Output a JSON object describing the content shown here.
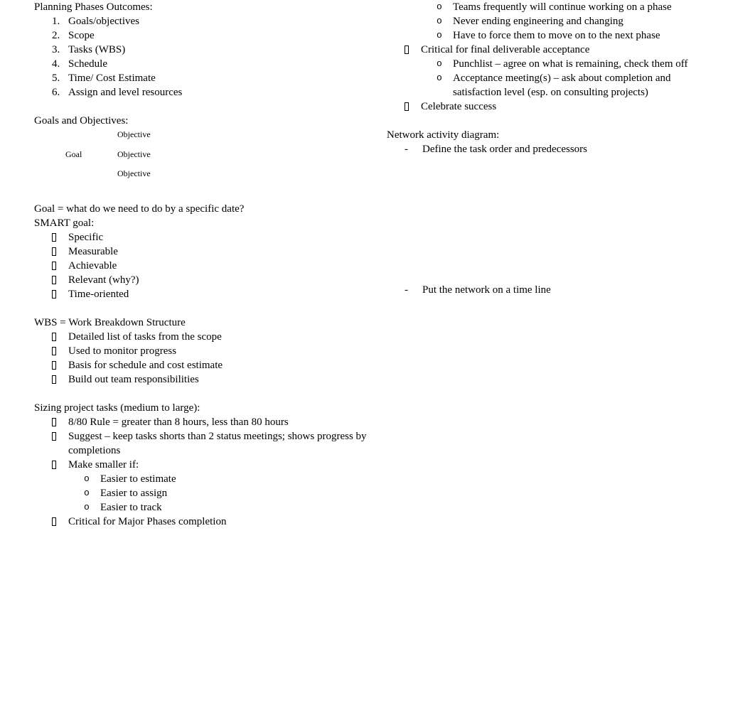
{
  "document": {
    "left_column": {
      "planning_phases": {
        "heading": "Planning Phases Outcomes:",
        "items": [
          {
            "marker": "1.",
            "label": "Goals/objectives"
          },
          {
            "marker": "2.",
            "label": "Scope"
          },
          {
            "marker": "3.",
            "label": "Tasks (WBS)"
          },
          {
            "marker": "4.",
            "label": "Schedule"
          },
          {
            "marker": "5.",
            "label": "Time/ Cost Estimate"
          },
          {
            "marker": "6.",
            "label": "Assign and level resources"
          }
        ]
      },
      "goals_objectives": {
        "heading": "Goals and Objectives:",
        "diagram": {
          "goal": "Goal",
          "objective_1": "Objective",
          "objective_2": "Objective",
          "objective_3": "Objective"
        }
      },
      "goal_definition": "Goal = what do we need to do by a specific date?",
      "smart_goal": {
        "heading": "SMART goal:",
        "items": [
          "Specific",
          "Measurable",
          "Achievable",
          "Relevant (why?)",
          "Time-oriented"
        ]
      },
      "wbs": {
        "heading": "WBS = Work Breakdown Structure",
        "items": [
          "Detailed list of tasks from the scope",
          "Used to monitor progress",
          "Basis for schedule and cost estimate",
          "Build out team responsibilities"
        ]
      },
      "sizing_tasks": {
        "heading": "Sizing project tasks (medium to large):",
        "item_1": "8/80 Rule = greater than 8 hours, less than 80 hours",
        "item_2": "Suggest – keep tasks shorts than 2 status meetings; shows progress by completions",
        "item_3": "Make smaller if:",
        "sub_items": [
          "Easier to estimate",
          "Easier to assign",
          "Easier to track"
        ],
        "item_4": "Critical for Major Phases completion"
      }
    },
    "right_column": {
      "phase_transition": {
        "sub_items": [
          "Teams frequently will continue working on a phase",
          "Never ending engineering and changing",
          "Have to force them to move on to the next phase"
        ]
      },
      "final_acceptance": {
        "item": "Critical for final deliverable acceptance",
        "sub_items": [
          "Punchlist – agree on what is remaining, check them off",
          "Acceptance meeting(s) – ask about completion and satisfaction level (esp. on consulting projects)"
        ]
      },
      "celebrate": "Celebrate success",
      "network_diagram": {
        "heading": "Network activity diagram:",
        "item_1": "Define the task order and predecessors",
        "item_2": "Put the network on a time line"
      }
    }
  },
  "markers": {
    "o_bullet": "o",
    "dash_bullet": "-"
  }
}
